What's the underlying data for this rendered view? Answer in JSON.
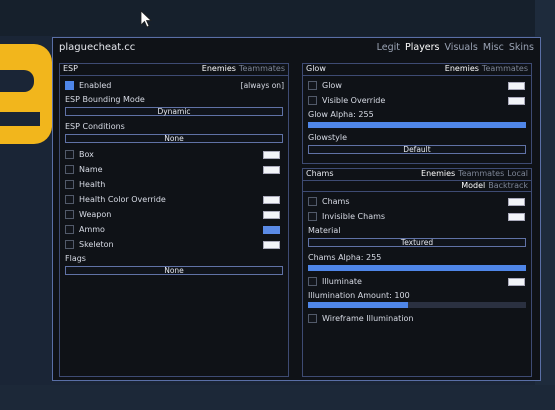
{
  "window": {
    "title": "plaguecheat.cc",
    "tabs": [
      "Legit",
      "Players",
      "Visuals",
      "Misc",
      "Skins"
    ],
    "active_tab": "Players"
  },
  "esp": {
    "title": "ESP",
    "filters": [
      "Enemies",
      "Teammates"
    ],
    "enabled_label": "Enabled",
    "enabled_hint": "[always on]",
    "bounding_label": "ESP Bounding Mode",
    "bounding_value": "Dynamic",
    "conditions_label": "ESP Conditions",
    "conditions_value": "None",
    "items": [
      "Box",
      "Name",
      "Health",
      "Health Color Override",
      "Weapon",
      "Ammo",
      "Skeleton"
    ],
    "flags_label": "Flags",
    "flags_value": "None"
  },
  "glow": {
    "title": "Glow",
    "filters": [
      "Enemies",
      "Teammates"
    ],
    "glow_label": "Glow",
    "visible_override_label": "Visible Override",
    "alpha_label": "Glow Alpha: 255",
    "alpha_fraction": 1.0,
    "style_label": "Glowstyle",
    "style_value": "Default"
  },
  "chams": {
    "title": "Chams",
    "filters": [
      "Enemies",
      "Teammates",
      "Local"
    ],
    "subfilters": [
      "Model",
      "Backtrack"
    ],
    "chams_label": "Chams",
    "invisible_label": "Invisible Chams",
    "material_label": "Material",
    "material_value": "Textured",
    "alpha_label": "Chams Alpha: 255",
    "alpha_fraction": 1.0,
    "illuminate_label": "Illuminate",
    "illumination_label": "Illumination Amount: 100",
    "illumination_fraction": 0.46,
    "wireframe_label": "Wireframe Illumination"
  },
  "colors": {
    "accent": "#4f86e8",
    "border": "#5a6fa6",
    "background": "#0f1217"
  }
}
